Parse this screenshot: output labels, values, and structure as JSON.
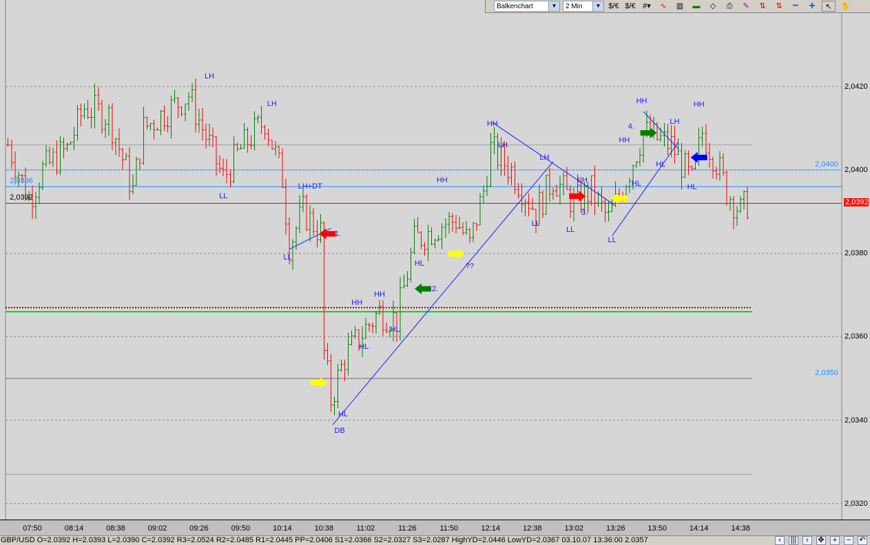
{
  "toolbar": {
    "chart_type": "Balkenchart",
    "interval": "2 Min",
    "icons": [
      "currency-dollar-euro-icon",
      "currency-dollar-euro-2-icon",
      "grid-icon",
      "indicator-icon",
      "color-palette-icon",
      "chart-bars-icon",
      "eraser-icon",
      "print-icon",
      "paint-icon",
      "arrows-updown-icon",
      "arrows-updown-2-icon",
      "zoom-out-icon",
      "zoom-in-icon",
      "pointer-icon",
      "hand-icon"
    ],
    "zoom_out": "−",
    "zoom_in": "+"
  },
  "status": {
    "text": "GBP/USD O=2.0392 H=2.0393 L=2.0390 C=2.0392  R3=2.0524 R2=2.0485 R1=2.0445 PP=2.0406 S1=2.0366 S2=2.0327 S3=2.0287 HighYD=2.0446 LowYD=2.0367  03.10.07 13:36:00 2.0357",
    "nav": [
      "‹",
      "|||",
      "›",
      "✥",
      "+",
      "−",
      "↶"
    ]
  },
  "chart_data": {
    "type": "bar",
    "symbol": "GBP/USD",
    "x_ticks": [
      "07:50",
      "08:14",
      "08:38",
      "09:02",
      "09:26",
      "09:50",
      "10:14",
      "10:38",
      "11:02",
      "11:26",
      "11:50",
      "12:14",
      "12:38",
      "13:02",
      "13:26",
      "13:50",
      "14:14",
      "14:38"
    ],
    "y_ticks": [
      "2,0420",
      "2,0400",
      "2,0380",
      "2,0360",
      "2,0340",
      "2,0320"
    ],
    "y_tick_values": [
      2.042,
      2.04,
      2.038,
      2.036,
      2.034,
      2.032
    ],
    "ylim": [
      2.0315,
      2.0442
    ],
    "current_price": "2,0392",
    "colors": {
      "up": "#008000",
      "down": "#ff0000",
      "annot": "#1a1aff"
    },
    "close_path": [
      [
        "07:36",
        2.0406
      ],
      [
        "07:48",
        2.0393
      ],
      [
        "07:56",
        2.04
      ],
      [
        "08:10",
        2.0405
      ],
      [
        "08:20",
        2.0415
      ],
      [
        "08:34",
        2.0413
      ],
      [
        "08:48",
        2.0395
      ],
      [
        "08:54",
        2.041
      ],
      [
        "09:20",
        2.0418
      ],
      [
        "09:26",
        2.0412
      ],
      [
        "09:40",
        2.0398
      ],
      [
        "09:50",
        2.0405
      ],
      [
        "10:04",
        2.0412
      ],
      [
        "10:14",
        2.0398
      ],
      [
        "10:18",
        2.0382
      ],
      [
        "10:26",
        2.039
      ],
      [
        "10:36",
        2.0385
      ],
      [
        "10:38",
        2.0356
      ],
      [
        "10:42",
        2.0345
      ],
      [
        "10:50",
        2.0355
      ],
      [
        "11:02",
        2.0362
      ],
      [
        "11:10",
        2.0366
      ],
      [
        "11:20",
        2.0364
      ],
      [
        "11:30",
        2.0383
      ],
      [
        "11:46",
        2.0387
      ],
      [
        "11:54",
        2.0388
      ],
      [
        "12:02",
        2.0382
      ],
      [
        "12:10",
        2.0395
      ],
      [
        "12:14",
        2.0405
      ],
      [
        "12:26",
        2.04
      ],
      [
        "12:40",
        2.039
      ],
      [
        "12:50",
        2.0398
      ],
      [
        "13:02",
        2.0392
      ],
      [
        "13:12",
        2.0395
      ],
      [
        "13:22",
        2.0388
      ],
      [
        "13:34",
        2.04
      ],
      [
        "13:42",
        2.0409
      ],
      [
        "13:58",
        2.0406
      ],
      [
        "14:10",
        2.0397
      ],
      [
        "14:16",
        2.0409
      ],
      [
        "14:24",
        2.0402
      ],
      [
        "14:30",
        2.0395
      ],
      [
        "14:38",
        2.039
      ],
      [
        "14:42",
        2.0392
      ]
    ],
    "hlines": [
      {
        "price": 2.0406,
        "color": "#a0a0a0",
        "style": "solid"
      },
      {
        "price": 2.04,
        "color": "#1e90ff",
        "style": "dotted",
        "label": "2,0400",
        "label_side": "right"
      },
      {
        "price": 2.0396,
        "color": "#1e90ff",
        "style": "solid",
        "label": "2,0396",
        "label_side": "left"
      },
      {
        "price": 2.0392,
        "color": "#ff0000",
        "style": "solid",
        "label": "2,0392",
        "label_side": "left"
      },
      {
        "price": 2.0367,
        "color": "#a00000",
        "style": "dotted"
      },
      {
        "price": 2.0366,
        "color": "#00e000",
        "style": "solid"
      },
      {
        "price": 2.035,
        "color": "#707070",
        "style": "solid",
        "label": "2,0350",
        "label_side": "right"
      },
      {
        "price": 2.0327,
        "color": "#a0a0a0",
        "style": "solid"
      }
    ],
    "labels": [
      {
        "text": "LH",
        "t": "09:32",
        "p": 2.04224
      },
      {
        "text": "LH",
        "t": "10:08",
        "p": 2.04158
      },
      {
        "text": "LL",
        "t": "09:40",
        "p": 2.03937
      },
      {
        "text": "LH+DT",
        "t": "10:30",
        "p": 2.0396
      },
      {
        "text": "LL",
        "t": "10:17",
        "p": 2.0379
      },
      {
        "text": "HH",
        "t": "11:46",
        "p": 2.03975
      },
      {
        "text": "HL",
        "t": "11:33",
        "p": 2.03776
      },
      {
        "text": "HH",
        "t": "10:57",
        "p": 2.03682
      },
      {
        "text": "HH",
        "t": "11:10",
        "p": 2.03701
      },
      {
        "text": "HL",
        "t": "11:01",
        "p": 2.03576
      },
      {
        "text": "HL",
        "t": "11:19",
        "p": 2.03617
      },
      {
        "text": "HL",
        "t": "10:49",
        "p": 2.03414
      },
      {
        "text": "DB",
        "t": "10:47",
        "p": 2.03375
      },
      {
        "text": "??",
        "t": "12:02",
        "p": 2.03769
      },
      {
        "text": "HH",
        "t": "12:15",
        "p": 2.0411
      },
      {
        "text": "LH",
        "t": "12:21",
        "p": 2.04059
      },
      {
        "text": "LH",
        "t": "12:45",
        "p": 2.0403
      },
      {
        "text": "LH",
        "t": "13:07",
        "p": 2.03975
      },
      {
        "text": "LL",
        "t": "12:40",
        "p": 2.03871
      },
      {
        "text": "LL",
        "t": "13:00",
        "p": 2.03856
      },
      {
        "text": "3.",
        "t": "13:08",
        "p": 2.03898
      },
      {
        "text": "LL",
        "t": "13:24",
        "p": 2.03832
      },
      {
        "text": "HH",
        "t": "13:31",
        "p": 2.04071
      },
      {
        "text": "HL",
        "t": "13:38",
        "p": 2.03967
      },
      {
        "text": "HH",
        "t": "13:41",
        "p": 2.04165
      },
      {
        "text": "4.",
        "t": "13:35",
        "p": 2.04104
      },
      {
        "text": "LH",
        "t": "14:00",
        "p": 2.04116
      },
      {
        "text": "HL",
        "t": "13:52",
        "p": 2.04013
      },
      {
        "text": "HH",
        "t": "14:14",
        "p": 2.04157
      },
      {
        "text": "HL",
        "t": "14:10",
        "p": 2.03959
      },
      {
        "text": "1.",
        "t": "10:46",
        "p": 2.03847
      },
      {
        "text": "2.",
        "t": "11:42",
        "p": 2.03715
      }
    ],
    "arrows": [
      {
        "t": "10:40",
        "p": 2.03847,
        "dir": "left",
        "color": "#ff0000"
      },
      {
        "t": "10:35",
        "p": 2.0349,
        "dir": "right",
        "color": "#ffff00"
      },
      {
        "t": "11:35",
        "p": 2.03715,
        "dir": "left",
        "color": "#008000"
      },
      {
        "t": "11:54",
        "p": 2.03799,
        "dir": "right",
        "color": "#ffff00"
      },
      {
        "t": "13:04",
        "p": 2.03937,
        "dir": "right",
        "color": "#ff0000"
      },
      {
        "t": "13:28",
        "p": 2.03932,
        "dir": "left",
        "color": "#ffff00"
      },
      {
        "t": "13:45",
        "p": 2.04089,
        "dir": "right",
        "color": "#008000"
      },
      {
        "t": "14:14",
        "p": 2.0403,
        "dir": "left",
        "color": "#0000ff"
      }
    ],
    "trendlines": [
      [
        [
          "10:18",
          2.0381
        ],
        [
          "10:42",
          2.0386
        ]
      ],
      [
        [
          "10:43",
          2.03389
        ],
        [
          "12:50",
          2.0402
        ]
      ],
      [
        [
          "12:15",
          2.04114
        ],
        [
          "13:25",
          2.03917
        ]
      ],
      [
        [
          "13:42",
          2.0414
        ],
        [
          "14:02",
          2.04051
        ]
      ],
      [
        [
          "13:24",
          2.03842
        ],
        [
          "14:02",
          2.04066
        ]
      ]
    ]
  }
}
